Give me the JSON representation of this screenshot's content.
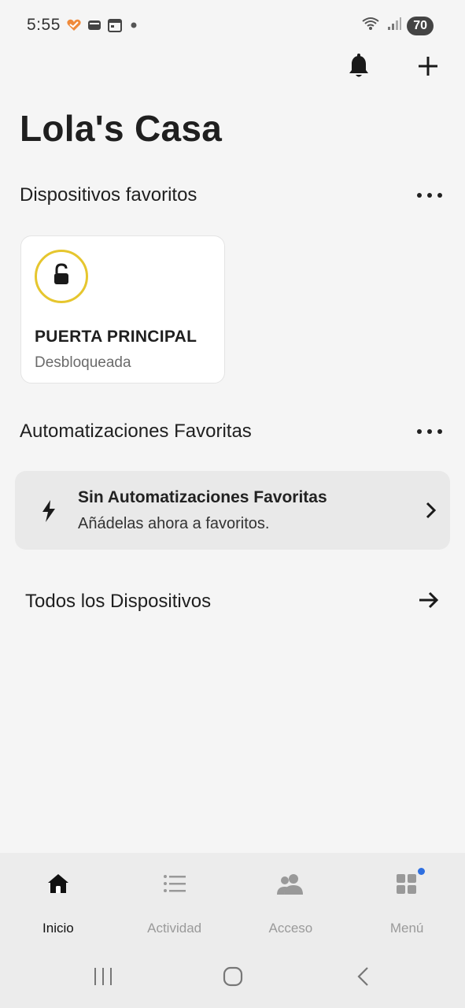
{
  "status_bar": {
    "time": "5:55",
    "battery": "70",
    "icons": [
      "heart-app-icon",
      "wallet-icon",
      "calendar-icon",
      "notification-dot-icon",
      "wifi-icon",
      "signal-icon"
    ]
  },
  "header": {
    "actions": [
      "bell-icon",
      "plus-icon"
    ]
  },
  "home": {
    "title": "Lola's Casa"
  },
  "favorites": {
    "title": "Dispositivos favoritos",
    "more_icon": "more-horizontal-icon",
    "devices": [
      {
        "name": "PUERTA PRINCIPAL",
        "status": "Desbloqueada",
        "icon": "unlocked-padlock-icon",
        "ring_color": "#e6c62e"
      }
    ]
  },
  "automations": {
    "title": "Automatizaciones Favoritas",
    "more_icon": "more-horizontal-icon",
    "empty_card": {
      "title": "Sin Automatizaciones Favoritas",
      "subtitle": "Añádelas ahora a favoritos.",
      "icon": "bolt-icon"
    }
  },
  "all_devices": {
    "label": "Todos los Dispositivos",
    "icon": "arrow-right-icon"
  },
  "bottom_nav": {
    "items": [
      {
        "label": "Inicio",
        "icon": "home-icon",
        "active": true
      },
      {
        "label": "Actividad",
        "icon": "list-icon",
        "active": false
      },
      {
        "label": "Acceso",
        "icon": "people-icon",
        "active": false
      },
      {
        "label": "Menú",
        "icon": "grid-menu-icon",
        "active": false,
        "badge": true
      }
    ],
    "badge_color": "#2e6fe0"
  },
  "colors": {
    "background": "#f5f5f5",
    "card": "#ffffff",
    "lock_ring": "#e6c62e",
    "empty_card": "#e9e9e9",
    "nav_bg": "#ececec"
  }
}
